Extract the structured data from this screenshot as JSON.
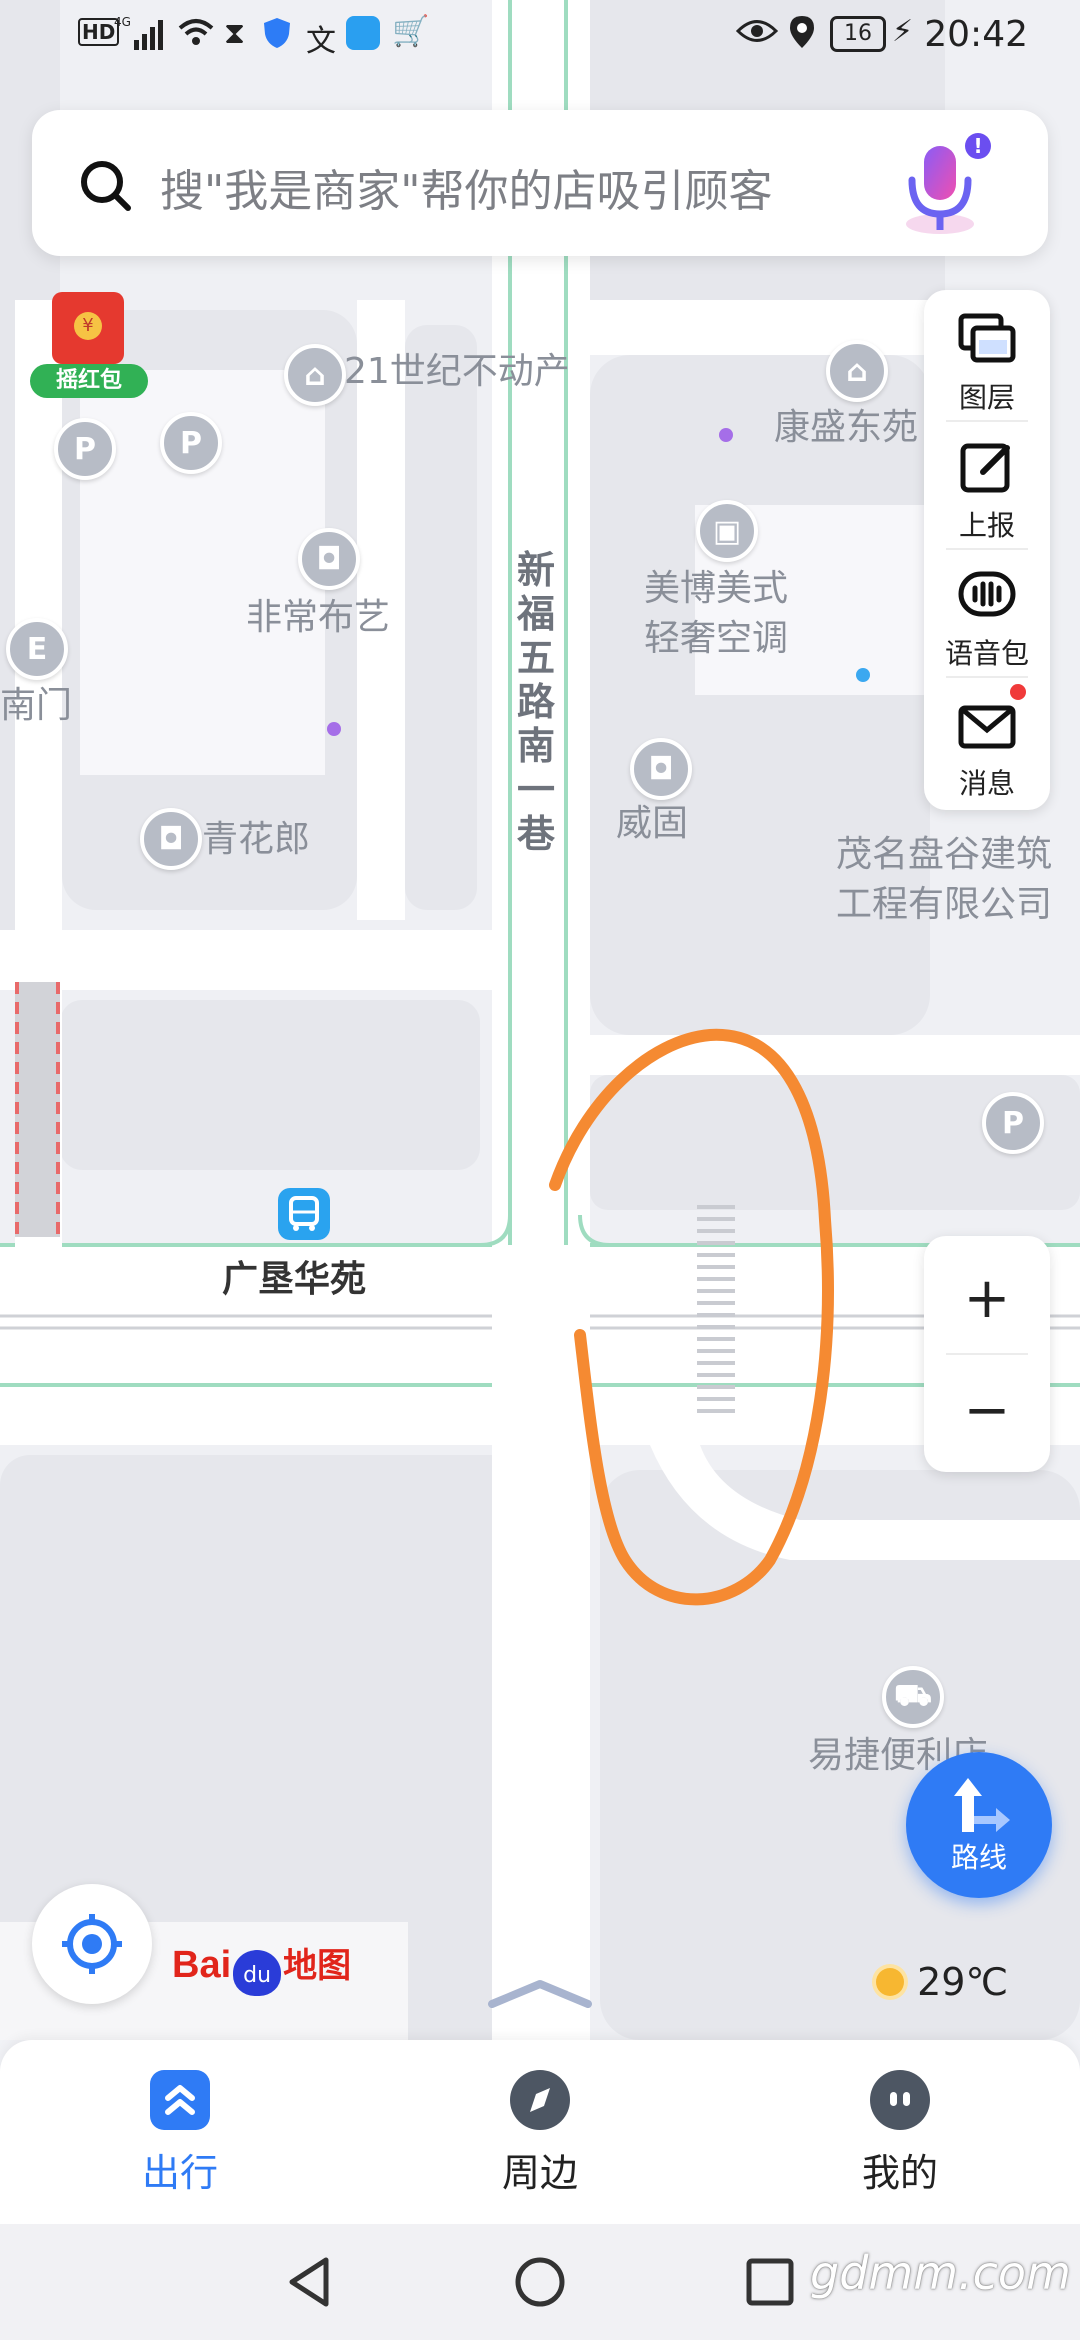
{
  "status_bar": {
    "time": "20:42",
    "battery": "16",
    "icons": [
      "hd-icon",
      "signal-4g-icon",
      "wifi-icon",
      "hourglass-icon",
      "shield-icon",
      "translate-icon",
      "weather-app-icon",
      "cart-icon",
      "eye-icon",
      "location-icon",
      "battery-icon",
      "charging-icon"
    ]
  },
  "search": {
    "placeholder": "搜\"我是商家\"帮你的店吸引顾客",
    "mic_icon": "microphone-icon"
  },
  "red_packet": {
    "label": "摇红包"
  },
  "tools": [
    {
      "label": "图层",
      "icon": "layers-icon"
    },
    {
      "label": "上报",
      "icon": "report-edit-icon"
    },
    {
      "label": "语音包",
      "icon": "voice-pack-icon"
    },
    {
      "label": "消息",
      "icon": "message-icon"
    }
  ],
  "map": {
    "pois": [
      {
        "name": "21世纪不动产"
      },
      {
        "name": "康盛东苑"
      },
      {
        "name": "美博美式\n轻奢空调"
      },
      {
        "name": "非常布艺"
      },
      {
        "name": "南门"
      },
      {
        "name": "青花郎"
      },
      {
        "name": "威固"
      },
      {
        "name": "茂名盘谷建筑\n工程有限公司"
      },
      {
        "name": "易捷便利店"
      },
      {
        "name": "广垦华苑"
      }
    ],
    "road_name": "新福五路南一巷",
    "road_chars": [
      "新",
      "福",
      "五",
      "路",
      "南",
      "一",
      "巷"
    ],
    "parking_label": "P",
    "colors": {
      "annotation": "#f58a32",
      "road_green": "#9fdcc0",
      "poi_gray": "#b7bcc6",
      "accent": "#2f7bf5"
    }
  },
  "zoom": {
    "in": "+",
    "out": "−"
  },
  "route": {
    "label": "路线"
  },
  "logo": {
    "text_bai": "Bai",
    "text_du": "du",
    "text_map": "地图"
  },
  "weather": {
    "temp": "29℃",
    "icon": "sun-icon"
  },
  "bottom_nav": [
    {
      "label": "出行",
      "icon": "travel-icon",
      "active": true
    },
    {
      "label": "周边",
      "icon": "compass-icon",
      "active": false
    },
    {
      "label": "我的",
      "icon": "profile-icon",
      "active": false
    }
  ],
  "watermark": "gdmm.com"
}
